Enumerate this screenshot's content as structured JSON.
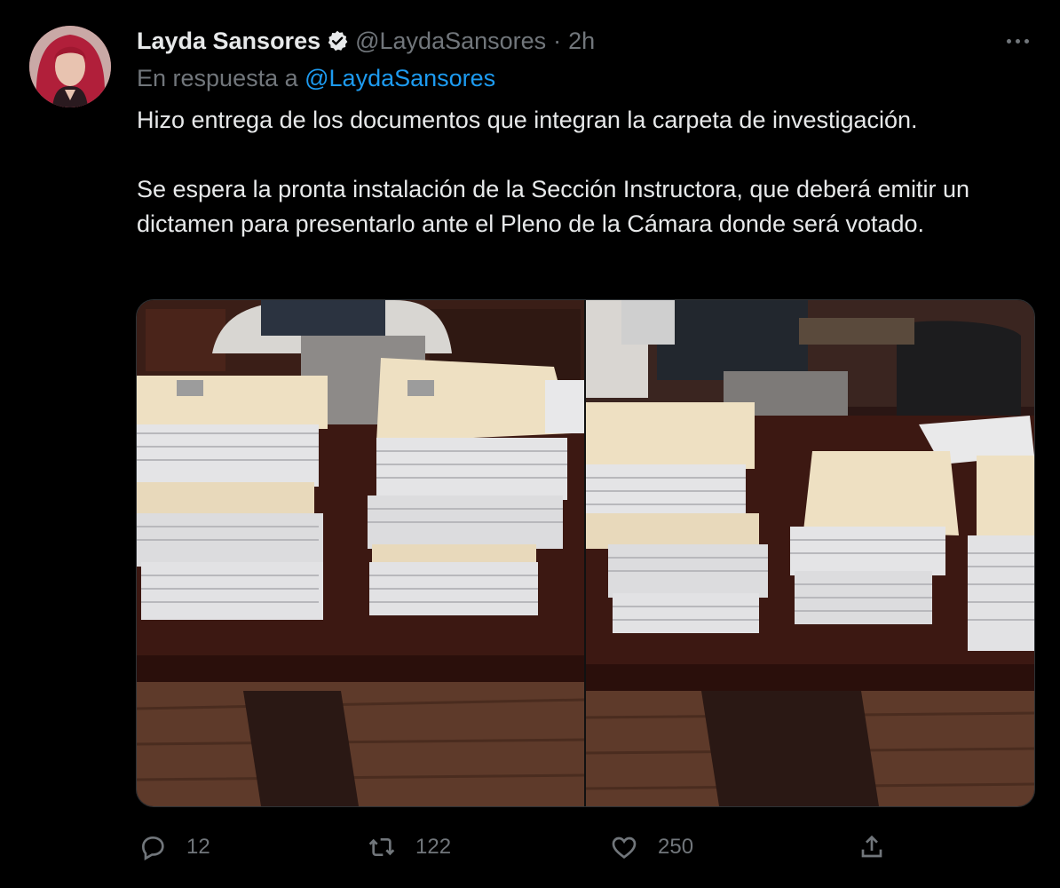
{
  "tweet": {
    "author": {
      "name": "Layda Sansores",
      "handle": "@LaydaSansores",
      "verified": true
    },
    "time": "2h",
    "separator": "·",
    "reply_to": {
      "prefix": "En respuesta a ",
      "handle": "@LaydaSansores"
    },
    "paragraphs": [
      "Hizo entrega de los documentos que integran la carpeta de investigación.",
      "Se espera la pronta instalación de la Sección Instructora, que deberá emitir un dictamen para presentarlo ante el Pleno de la Cámara donde será votado."
    ],
    "media": [
      {
        "icon": "photo",
        "description": "Stacks of paper folders on a desk"
      },
      {
        "icon": "photo",
        "description": "Stacks of paper folders on a desk, second view"
      }
    ],
    "actions": {
      "replies": "12",
      "retweets": "122",
      "likes": "250"
    }
  },
  "colors": {
    "background": "#000000",
    "text": "#e7e9ea",
    "secondary": "#71767b",
    "link": "#1d9bf0"
  },
  "icons": [
    "more-icon",
    "verified-icon",
    "reply-icon",
    "retweet-icon",
    "like-icon",
    "share-icon"
  ]
}
